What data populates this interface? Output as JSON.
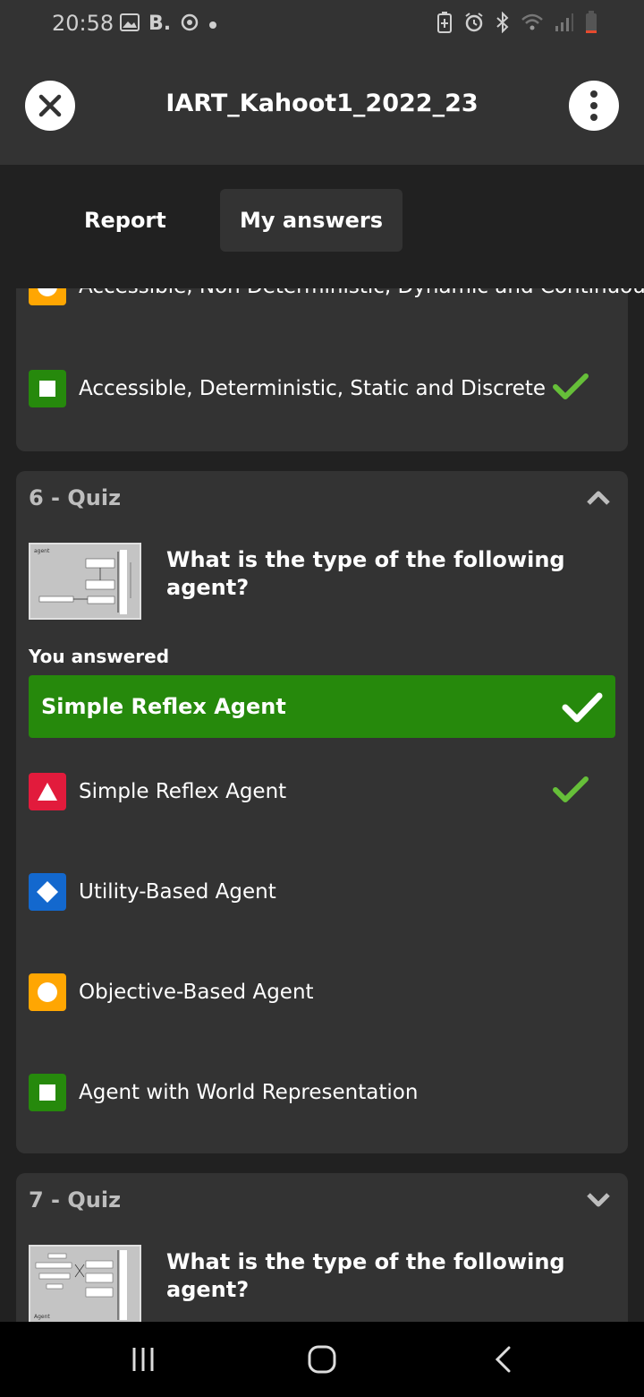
{
  "status_bar": {
    "time": "20:58",
    "left_icons": [
      "gallery-icon",
      "b-app-icon",
      "sync-icon",
      "dot-icon"
    ],
    "right_icons": [
      "battery-saver-icon",
      "alarm-icon",
      "bluetooth-icon",
      "wifi-icon",
      "signal-icon",
      "battery-low-icon"
    ],
    "b_label": "B."
  },
  "header": {
    "title": "IART_Kahoot1_2022_23"
  },
  "tabs": [
    {
      "label": "Report",
      "active": false
    },
    {
      "label": "My answers",
      "active": true
    }
  ],
  "previous_card": {
    "answers": [
      {
        "text": "Accessible, Non Deterministic, Dynamic and Continuous",
        "shape": "circle",
        "color": "#ffa602",
        "correct": false
      },
      {
        "text": "Accessible, Deterministic, Static and Discrete",
        "shape": "square",
        "color": "#26890c",
        "correct": true
      }
    ]
  },
  "quiz6": {
    "heading": "6 - Quiz",
    "question": "What is the type of the following agent?",
    "you_answered_label": "You answered",
    "your_answer": "Simple Reflex Agent",
    "answers": [
      {
        "text": "Simple Reflex Agent",
        "shape": "triangle",
        "color": "#e21b3c",
        "correct": true
      },
      {
        "text": "Utility-Based Agent",
        "shape": "diamond",
        "color": "#1368ce",
        "correct": false
      },
      {
        "text": "Objective-Based Agent",
        "shape": "circle",
        "color": "#ffa602",
        "correct": false
      },
      {
        "text": "Agent with World Representation",
        "shape": "square",
        "color": "#26890c",
        "correct": false
      }
    ]
  },
  "quiz7": {
    "heading": "7 - Quiz",
    "question": "What is the type of the following agent?"
  },
  "colors": {
    "correct_check": "#66bf39",
    "answer_bar": "#26890c",
    "card_bg": "#333333",
    "page_bg": "#212121"
  }
}
